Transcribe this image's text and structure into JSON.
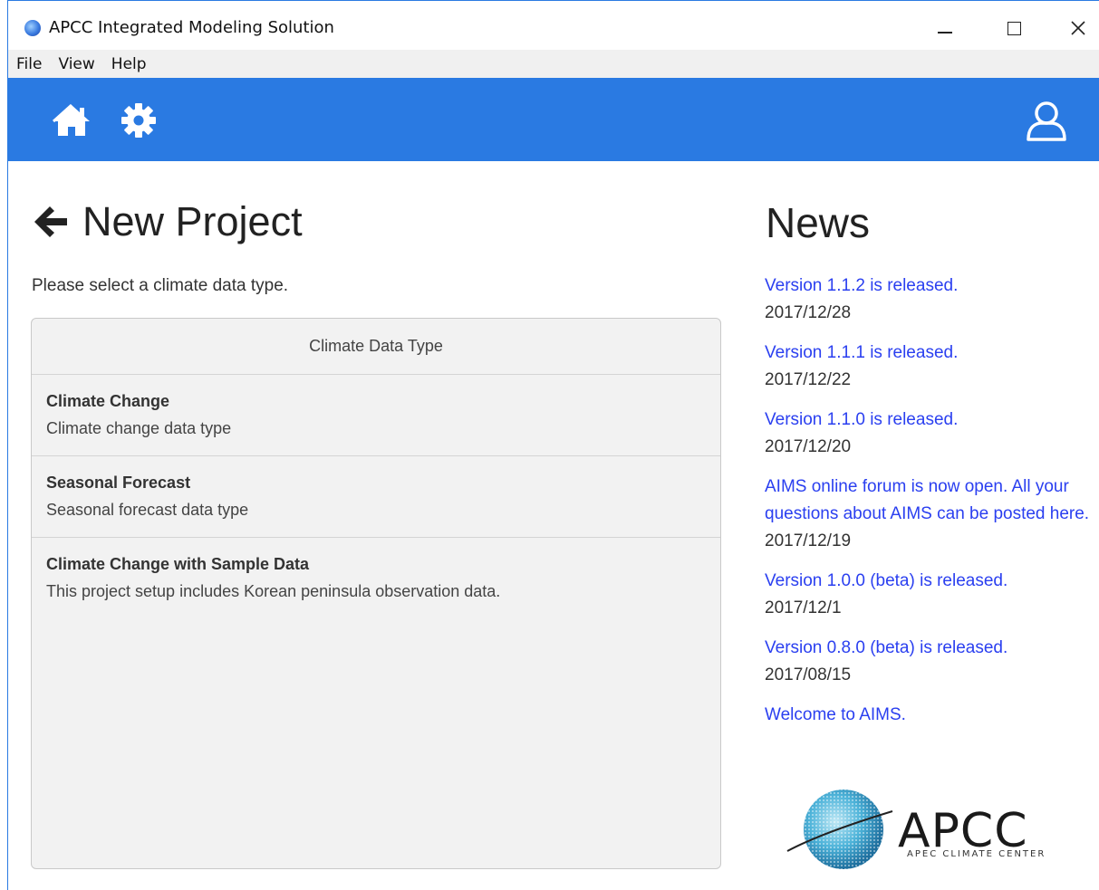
{
  "window": {
    "title": "APCC Integrated Modeling Solution"
  },
  "menu": {
    "items": [
      "File",
      "View",
      "Help"
    ]
  },
  "toolbar": {
    "icons": [
      "home-icon",
      "gear-icon",
      "user-icon"
    ],
    "color": "#2a7ae2"
  },
  "main": {
    "title": "New Project",
    "instruction": "Please select a climate data type.",
    "panel": {
      "header": "Climate Data Type",
      "items": [
        {
          "name": "Climate Change",
          "desc": "Climate change data type"
        },
        {
          "name": "Seasonal Forecast",
          "desc": "Seasonal forecast data type"
        },
        {
          "name": "Climate Change with Sample Data",
          "desc": "This project setup includes Korean peninsula observation data."
        }
      ]
    }
  },
  "news": {
    "title": "News",
    "items": [
      {
        "text": "Version 1.1.2 is released.",
        "date": "2017/12/28"
      },
      {
        "text": "Version 1.1.1 is released.",
        "date": "2017/12/22"
      },
      {
        "text": "Version 1.1.0 is released.",
        "date": "2017/12/20"
      },
      {
        "text": "AIMS online forum is now open. All your questions about AIMS can be posted here.",
        "date": "2017/12/19"
      },
      {
        "text": "Version 1.0.0 (beta) is released.",
        "date": "2017/12/1"
      },
      {
        "text": "Version 0.8.0 (beta) is released.",
        "date": "2017/08/15"
      },
      {
        "text": "Welcome to AIMS.",
        "date": ""
      }
    ]
  },
  "logo": {
    "name": "APCC",
    "subtitle": "APEC CLIMATE CENTER"
  }
}
